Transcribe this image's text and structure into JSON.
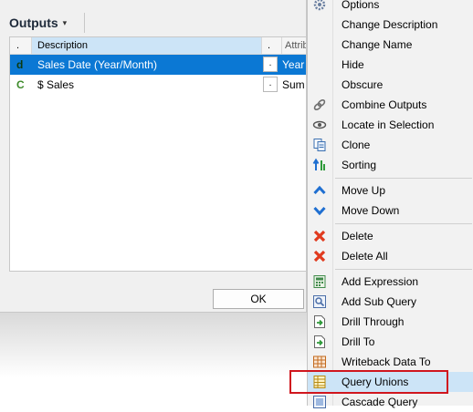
{
  "dialog": {
    "outputs_title": "Outputs",
    "outputs_caret": "▾",
    "grid": {
      "header": {
        "col1": ".",
        "col2": "Description",
        "col3": ".",
        "col4": "Attribu"
      },
      "rows": [
        {
          "icon": "d",
          "description": "Sales Date (Year/Month)",
          "btn": ".",
          "attr": "Year /",
          "selected": true
        },
        {
          "icon": "C",
          "description": "$ Sales",
          "btn": ".",
          "attr": "Sum %",
          "selected": false
        }
      ]
    },
    "ok_label": "OK"
  },
  "menu": {
    "items": [
      {
        "label": "Options",
        "icon": "gear-icon"
      },
      {
        "label": "Change Description",
        "icon": ""
      },
      {
        "label": "Change Name",
        "icon": ""
      },
      {
        "label": "Hide",
        "icon": ""
      },
      {
        "label": "Obscure",
        "icon": ""
      },
      {
        "label": "Combine Outputs",
        "icon": "chain-icon"
      },
      {
        "label": "Locate in Selection",
        "icon": "eye-icon"
      },
      {
        "label": "Clone",
        "icon": "clone-icon"
      },
      {
        "label": "Sorting",
        "icon": "sort-icon"
      },
      {
        "label": "Move Up",
        "icon": "chevron-up-icon"
      },
      {
        "label": "Move Down",
        "icon": "chevron-down-icon"
      },
      {
        "label": "Delete",
        "icon": "delete-icon"
      },
      {
        "label": "Delete All",
        "icon": "delete-all-icon"
      },
      {
        "label": "Add Expression",
        "icon": "expression-icon"
      },
      {
        "label": "Add Sub Query",
        "icon": "sub-query-icon"
      },
      {
        "label": "Drill Through",
        "icon": "drill-through-icon"
      },
      {
        "label": "Drill To",
        "icon": "drill-to-icon"
      },
      {
        "label": "Writeback Data To",
        "icon": "writeback-icon"
      },
      {
        "label": "Query Unions",
        "icon": "query-unions-icon"
      },
      {
        "label": "Cascade Query",
        "icon": "cascade-query-icon"
      }
    ]
  },
  "colors": {
    "selection": "#0b78d4",
    "highlight_box": "#d0161e",
    "menu_hover": "#cce4f7",
    "chevron_blue": "#1f6fd1",
    "delete_red": "#e03a1e"
  }
}
